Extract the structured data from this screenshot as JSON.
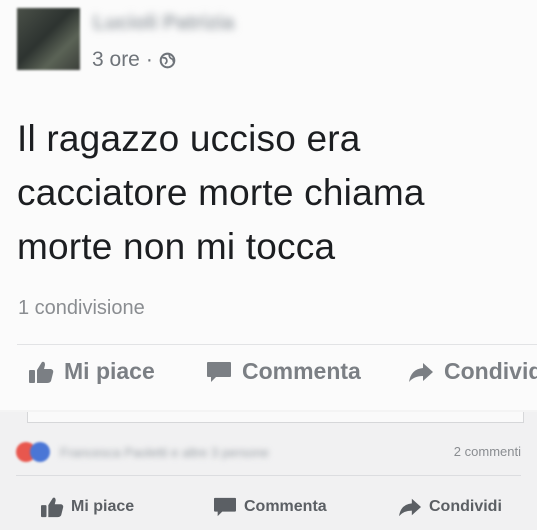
{
  "post": {
    "author": "Lucioli Patrizia",
    "time": "3 ore",
    "separator": "·",
    "privacy_icon": "globe-icon",
    "text": "Il ragazzo ucciso era\ncacciatore morte chiama\nmorte non mi tocca",
    "shares": "1 condivisione"
  },
  "actions": {
    "like": "Mi piace",
    "comment": "Commenta",
    "share": "Condividi"
  },
  "lower": {
    "reactions_names": "Francesca Paoletti e altre 3 persone",
    "comments_count": "2 commenti"
  },
  "actions_bottom": {
    "like": "Mi piace",
    "comment": "Commenta",
    "share": "Condividi"
  },
  "colors": {
    "text": "#1c1e21",
    "muted": "#7b7f84",
    "like_reaction": "#4a76d6",
    "love_reaction": "#e8574e"
  }
}
